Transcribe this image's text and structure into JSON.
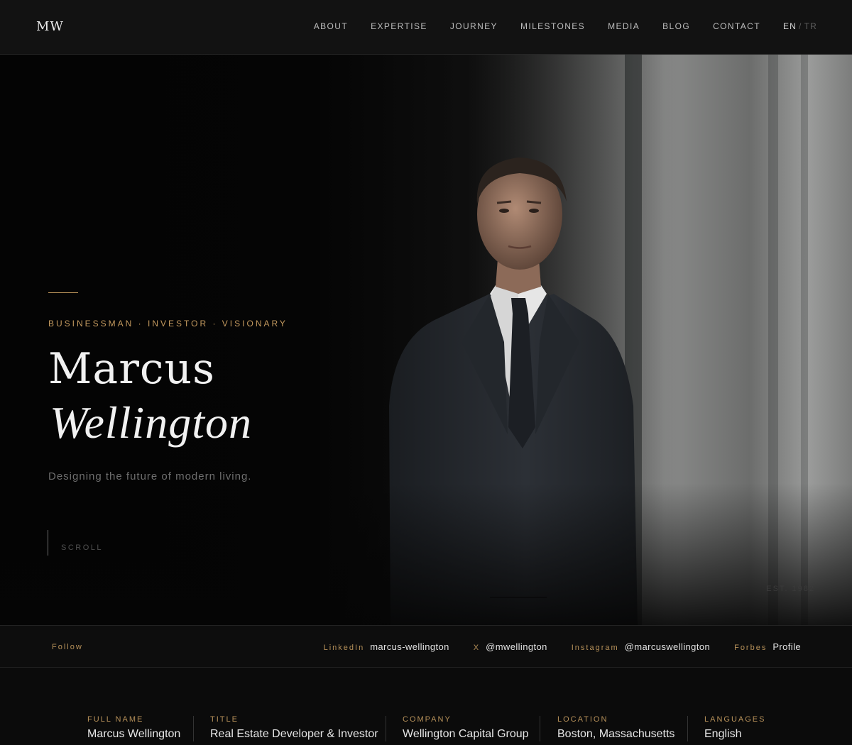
{
  "header": {
    "logo": "MW",
    "nav": [
      "ABOUT",
      "EXPERTISE",
      "JOURNEY",
      "MILESTONES",
      "MEDIA",
      "BLOG",
      "CONTACT"
    ],
    "lang": {
      "en": "EN",
      "sep": "/",
      "tr": "TR"
    }
  },
  "hero": {
    "tagline": "BUSINESSMAN · INVESTOR · VISIONARY",
    "first_name": "Marcus",
    "last_name": "Wellington",
    "subline": "Designing the future of modern living.",
    "scroll": "SCROLL",
    "est": "EST. 1982"
  },
  "follow": {
    "label": "Follow",
    "socials": [
      {
        "network": "LinkedIn",
        "handle": "marcus-wellington"
      },
      {
        "network": "X",
        "handle": "@mwellington"
      },
      {
        "network": "Instagram",
        "handle": "@marcuswellington"
      },
      {
        "network": "Forbes",
        "handle": "Profile"
      }
    ]
  },
  "facts": [
    {
      "label": "FULL NAME",
      "value": "Marcus Wellington"
    },
    {
      "label": "TITLE",
      "value": "Real Estate Developer & Investor"
    },
    {
      "label": "COMPANY",
      "value": "Wellington Capital Group"
    },
    {
      "label": "LOCATION",
      "value": "Boston, Massachusetts"
    },
    {
      "label": "LANGUAGES",
      "value": "English"
    }
  ],
  "colors": {
    "accent": "#c49a5f",
    "background": "#0b0b0b",
    "text": "#e6e6e6"
  }
}
